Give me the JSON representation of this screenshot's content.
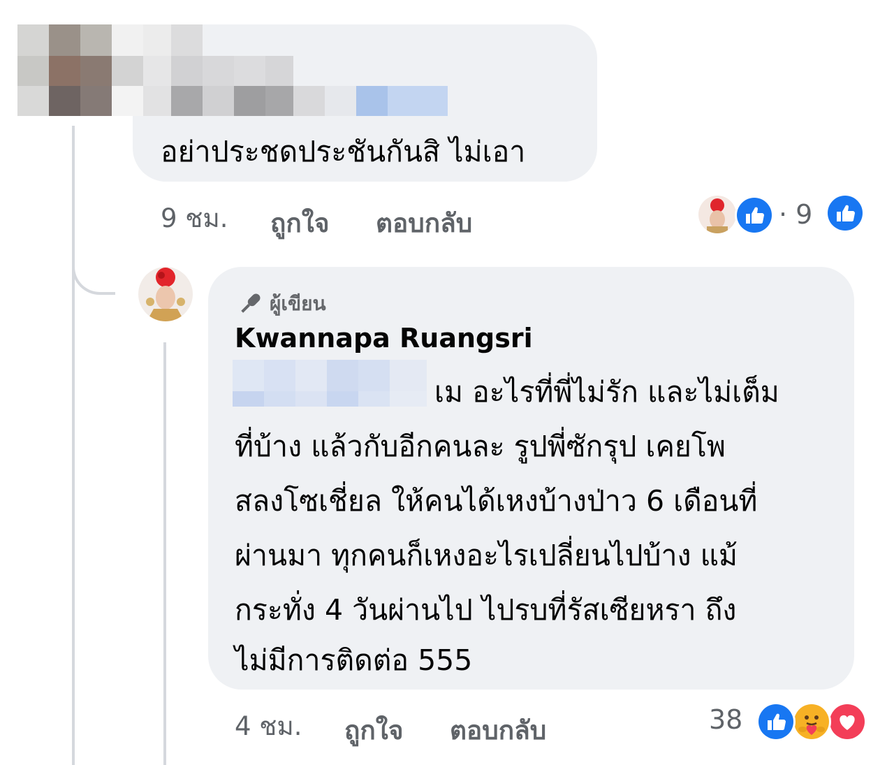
{
  "comment1": {
    "text": "อย่าประชดประชันกันสิ ไม่เอา",
    "time": "9 ชม.",
    "like_label": "ถูกใจ",
    "reply_label": "ตอบกลับ",
    "reaction_count": "· 9",
    "author_blurred": true
  },
  "comment2": {
    "badge": "ผู้เขียน",
    "author": "Kwannapa Ruangsri",
    "lines": [
      "เม อะไรที่พี่ไม่รัก และไม่เต็ม",
      "ที่บ้าง แล้วกับอีกคนละ รูปพี่ซักรุป เคยโพ",
      "สลงโซเชี่ยล ให้คนได้เหงบ้างป่าว 6 เดือนที่",
      "ผ่านมา ทุกคนก็เหงอะไรเปลี่ยนไปบ้าง แม้",
      "กระทั่ง 4 วันผ่านไป ไปรบที่รัสเซียหรา ถึง",
      "ไม่มีการติดต่อ 555"
    ],
    "time": "4 ชม.",
    "like_label": "ถูกใจ",
    "reply_label": "ตอบกลับ",
    "reaction_count": "38"
  },
  "icons": {
    "like": "like-icon",
    "care": "care-icon",
    "love": "love-icon",
    "author": "microphone-icon"
  },
  "colors": {
    "bubble": "#eff1f4",
    "like_blue": "#1877f2",
    "love_red": "#f33e58",
    "care_yellow": "#f7b125",
    "meta_gray": "#5f6368"
  }
}
